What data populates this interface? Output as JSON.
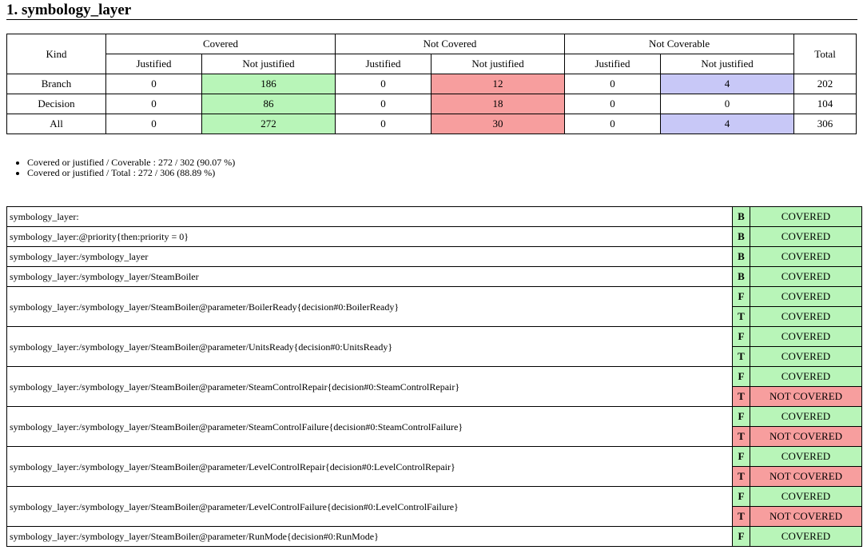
{
  "heading": "1. symbology_layer",
  "summary": {
    "kind_header": "Kind",
    "groups": [
      "Covered",
      "Not Covered",
      "Not Coverable"
    ],
    "total_header": "Total",
    "sub_headers": [
      "Justified",
      "Not justified"
    ],
    "rows": [
      {
        "kind": "Branch",
        "values": [
          "0",
          "186",
          "0",
          "12",
          "0",
          "4"
        ],
        "total": "202"
      },
      {
        "kind": "Decision",
        "values": [
          "0",
          "86",
          "0",
          "18",
          "0",
          "0"
        ],
        "total": "104"
      },
      {
        "kind": "All",
        "values": [
          "0",
          "272",
          "0",
          "30",
          "0",
          "4"
        ],
        "total": "306"
      }
    ]
  },
  "notes": [
    "Covered or justified / Coverable : 272 / 302 (90.07 %)",
    "Covered or justified / Total : 272 / 306 (88.89 %)"
  ],
  "details": [
    {
      "path": "symbology_layer:",
      "entries": [
        {
          "k": "B",
          "s": "COVERED"
        }
      ]
    },
    {
      "path": "symbology_layer:@priority{then:priority = 0}",
      "entries": [
        {
          "k": "B",
          "s": "COVERED"
        }
      ]
    },
    {
      "path": "symbology_layer:/symbology_layer",
      "entries": [
        {
          "k": "B",
          "s": "COVERED"
        }
      ]
    },
    {
      "path": "symbology_layer:/symbology_layer/SteamBoiler",
      "entries": [
        {
          "k": "B",
          "s": "COVERED"
        }
      ]
    },
    {
      "path": "symbology_layer:/symbology_layer/SteamBoiler@parameter/BoilerReady{decision#0:BoilerReady}",
      "entries": [
        {
          "k": "F",
          "s": "COVERED"
        },
        {
          "k": "T",
          "s": "COVERED"
        }
      ]
    },
    {
      "path": "symbology_layer:/symbology_layer/SteamBoiler@parameter/UnitsReady{decision#0:UnitsReady}",
      "entries": [
        {
          "k": "F",
          "s": "COVERED"
        },
        {
          "k": "T",
          "s": "COVERED"
        }
      ]
    },
    {
      "path": "symbology_layer:/symbology_layer/SteamBoiler@parameter/SteamControlRepair{decision#0:SteamControlRepair}",
      "entries": [
        {
          "k": "F",
          "s": "COVERED"
        },
        {
          "k": "T",
          "s": "NOT COVERED"
        }
      ]
    },
    {
      "path": "symbology_layer:/symbology_layer/SteamBoiler@parameter/SteamControlFailure{decision#0:SteamControlFailure}",
      "entries": [
        {
          "k": "F",
          "s": "COVERED"
        },
        {
          "k": "T",
          "s": "NOT COVERED"
        }
      ]
    },
    {
      "path": "symbology_layer:/symbology_layer/SteamBoiler@parameter/LevelControlRepair{decision#0:LevelControlRepair}",
      "entries": [
        {
          "k": "F",
          "s": "COVERED"
        },
        {
          "k": "T",
          "s": "NOT COVERED"
        }
      ]
    },
    {
      "path": "symbology_layer:/symbology_layer/SteamBoiler@parameter/LevelControlFailure{decision#0:LevelControlFailure}",
      "entries": [
        {
          "k": "F",
          "s": "COVERED"
        },
        {
          "k": "T",
          "s": "NOT COVERED"
        }
      ]
    },
    {
      "path": "symbology_layer:/symbology_layer/SteamBoiler@parameter/RunMode{decision#0:RunMode}",
      "entries": [
        {
          "k": "F",
          "s": "COVERED"
        }
      ]
    }
  ],
  "colors": {
    "covered": "#b8f5b8",
    "not_covered": "#f79e9e",
    "not_coverable": "#c8c8f7"
  }
}
